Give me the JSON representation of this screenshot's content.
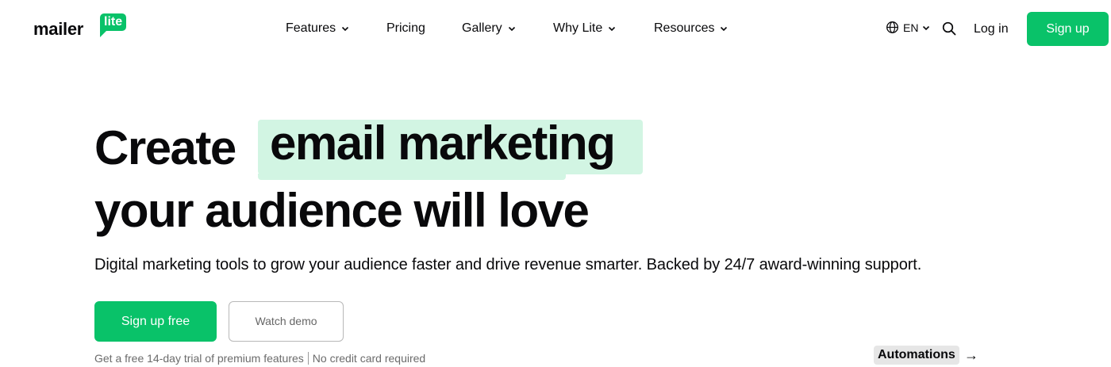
{
  "brand": {
    "word": "mailer",
    "badge": "lite"
  },
  "nav": {
    "items": [
      {
        "label": "Features",
        "dropdown": true
      },
      {
        "label": "Pricing",
        "dropdown": false
      },
      {
        "label": "Gallery",
        "dropdown": true
      },
      {
        "label": "Why Lite",
        "dropdown": true
      },
      {
        "label": "Resources",
        "dropdown": true
      }
    ],
    "language": "EN",
    "login": "Log in",
    "signup": "Sign up"
  },
  "hero": {
    "line1_start": "Create",
    "line1_highlight": "email marketing",
    "line2": "your audience will love",
    "subtitle": "Digital marketing tools to grow your audience faster and drive revenue smarter. Backed by 24/7 award-winning support.",
    "cta_primary": "Sign up free",
    "cta_secondary": "Watch demo",
    "note_left": "Get a free 14-day trial of premium features",
    "note_right": "No credit card required",
    "feature_tag": "Automations",
    "feature_arrow": "→"
  },
  "colors": {
    "accent": "#09c269",
    "highlight": "#d2f5e3",
    "text": "#09090b"
  }
}
